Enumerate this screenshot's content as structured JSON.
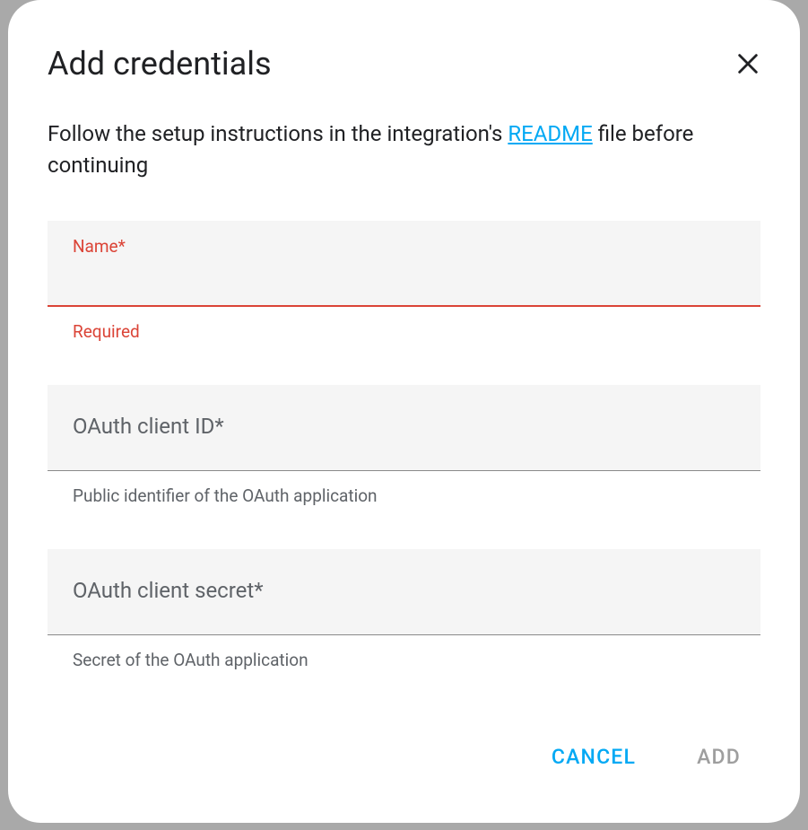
{
  "dialog": {
    "title": "Add credentials",
    "instructions_prefix": "Follow the setup instructions in the integration's ",
    "readme_link_text": "README",
    "instructions_suffix": " file before continuing"
  },
  "fields": {
    "name": {
      "label": "Name*",
      "error": "Required"
    },
    "client_id": {
      "label": "OAuth client ID*",
      "helper": "Public identifier of the OAuth application"
    },
    "client_secret": {
      "label": "OAuth client secret*",
      "helper": "Secret of the OAuth application"
    }
  },
  "actions": {
    "cancel": "CANCEL",
    "add": "ADD"
  }
}
